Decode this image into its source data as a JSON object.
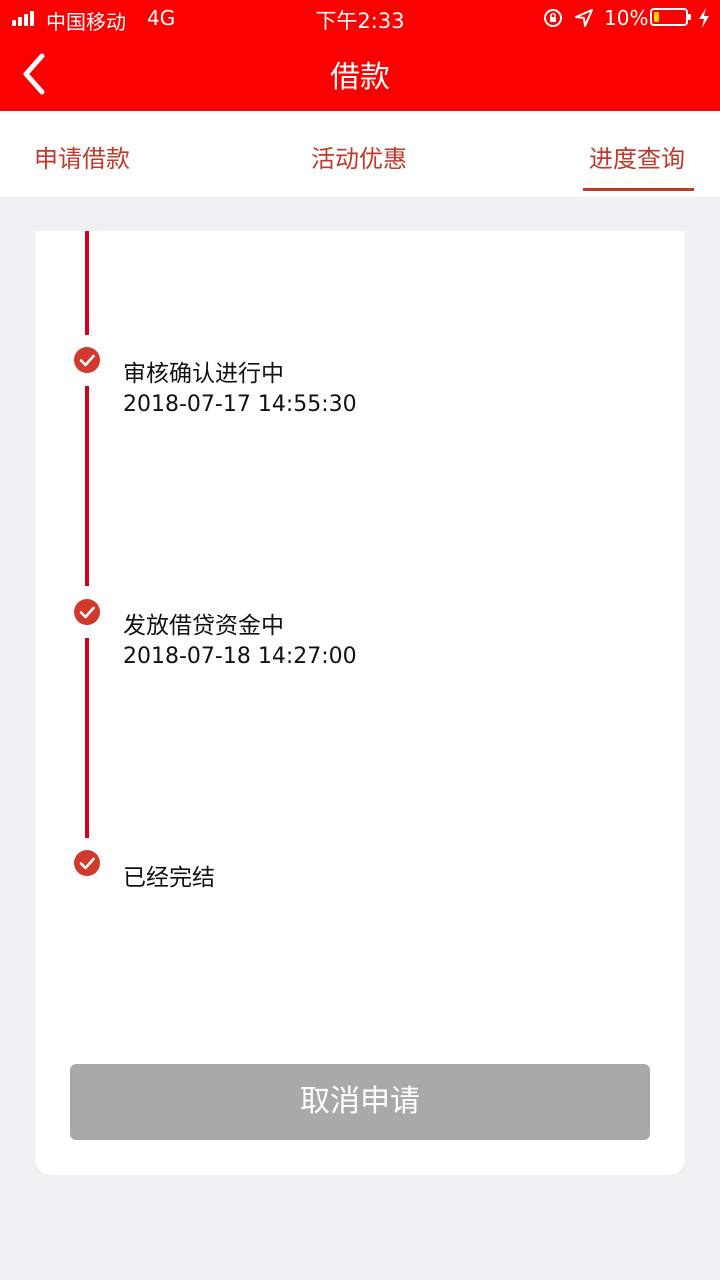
{
  "status_bar": {
    "carrier": "中国移动",
    "network": "4G",
    "time": "下午2:33",
    "battery_percent": "10%",
    "battery_level": 0.1
  },
  "nav": {
    "title": "借款",
    "back_icon": "chevron-left-icon"
  },
  "tabs": [
    {
      "label": "申请借款",
      "active": false
    },
    {
      "label": "活动优惠",
      "active": false
    },
    {
      "label": "进度查询",
      "active": true
    }
  ],
  "timeline": [
    {
      "title": "审核确认进行中",
      "time": "2018-07-17 14:55:30",
      "icon": "check-circle-icon"
    },
    {
      "title": "发放借贷资金中",
      "time": "2018-07-18 14:27:00",
      "icon": "check-circle-icon"
    },
    {
      "title": "已经完结",
      "time": "",
      "icon": "check-circle-icon"
    }
  ],
  "cancel_button": {
    "label": "取消申请"
  },
  "colors": {
    "header": "#fb0000",
    "accent": "#c0392b",
    "timeline": "#d0021b",
    "disabled_button": "#a9a9a9",
    "background": "#efeff4"
  }
}
